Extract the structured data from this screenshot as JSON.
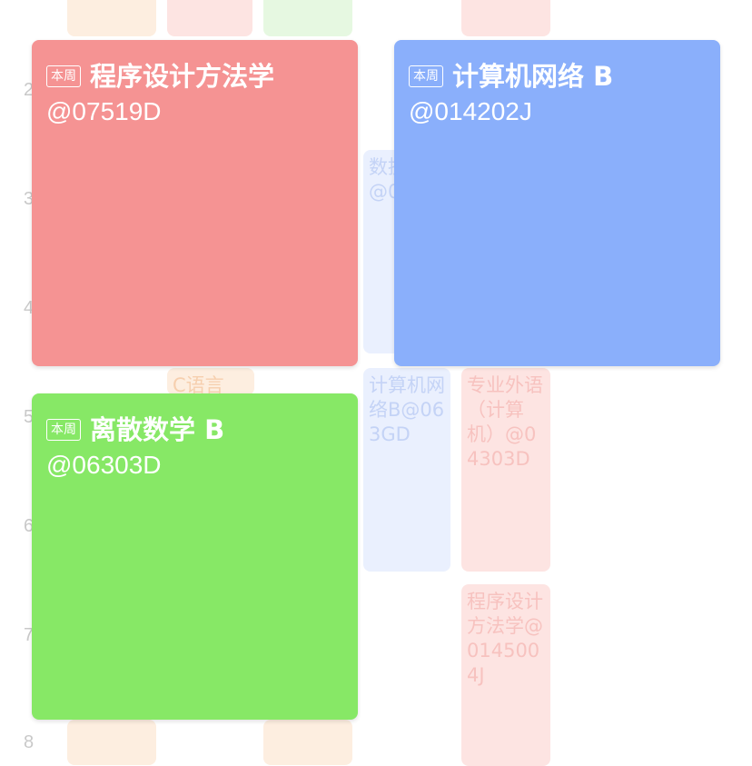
{
  "row_numbers": [
    "2",
    "3",
    "4",
    "5",
    "6",
    "7",
    "8"
  ],
  "ghost_courses": [
    {
      "text": "数据结构@063D",
      "color": "blue"
    },
    {
      "text": "计算机网络B@063GD",
      "color": "blue"
    },
    {
      "text": "专业外语（计算机）@04303D",
      "color": "red"
    },
    {
      "text": "程序设计方法学@0145004J",
      "color": "red"
    },
    {
      "text": "C语言",
      "color": "orange"
    }
  ],
  "cards": [
    {
      "badge": "本周",
      "name": "程序设计方法学",
      "room": "@07519D",
      "color": "#f59393"
    },
    {
      "badge": "本周",
      "name": "计算机网络 B",
      "room": "@014202J",
      "color": "#8aaffb"
    },
    {
      "badge": "本周",
      "name": "离散数学 B",
      "room": "@06303D",
      "color": "#87e866"
    }
  ]
}
